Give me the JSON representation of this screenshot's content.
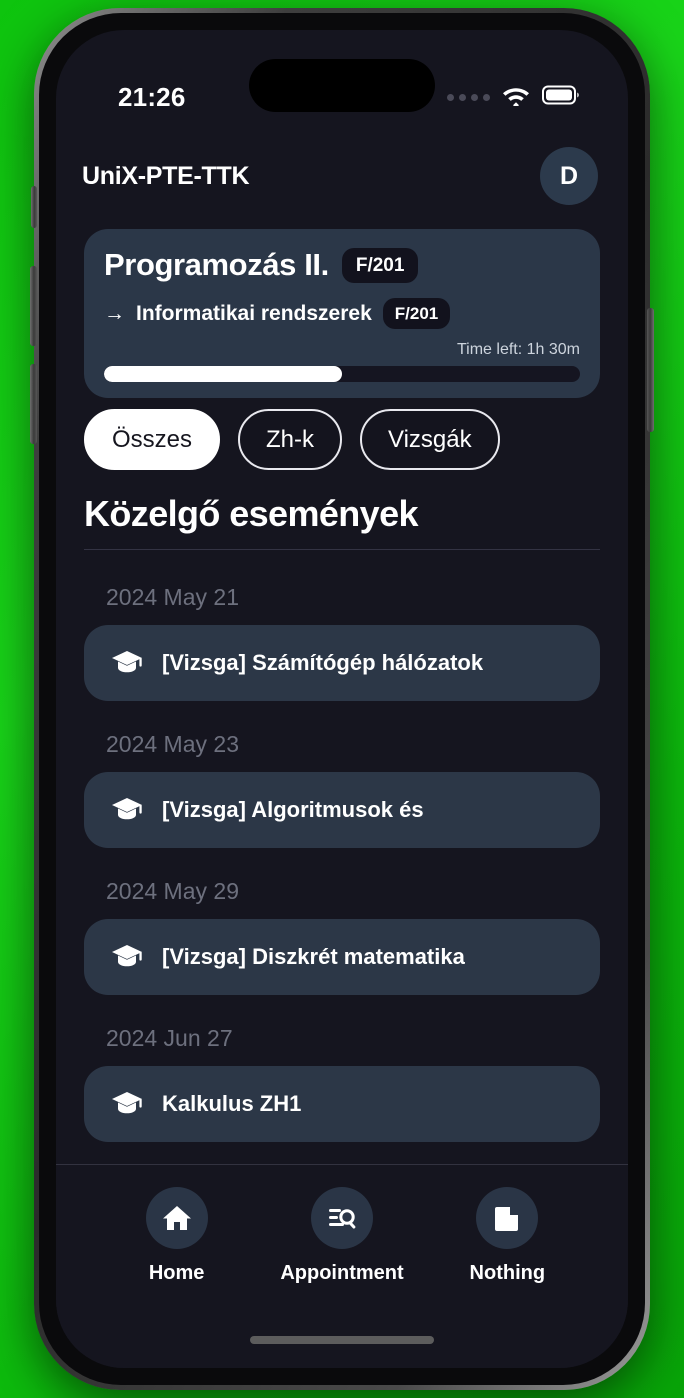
{
  "device": {
    "frame": "iphone-mockup",
    "backdrop_color": "#13c913",
    "screen_bg": "#15151f"
  },
  "status_bar": {
    "time": "21:26",
    "cellular_icon": "cellular-dots-icon",
    "wifi_icon": "wifi-icon",
    "battery_icon": "battery-full-icon"
  },
  "header": {
    "title": "UniX-PTE-TTK",
    "avatar_initial": "D"
  },
  "current_class_card": {
    "title": "Programozás II.",
    "room": "F/201",
    "next_arrow": "→",
    "next_title": "Informatikai rendszerek",
    "next_room": "F/201",
    "time_left": "Time left: 1h 30m",
    "progress_percent": 50
  },
  "filters": [
    {
      "label": "Összes",
      "active": true
    },
    {
      "label": "Zh-k",
      "active": false
    },
    {
      "label": "Vizsgák",
      "active": false
    }
  ],
  "events_section": {
    "heading": "Közelgő események",
    "groups": [
      {
        "date": "2024 May 21",
        "items": [
          {
            "icon": "graduation-cap-icon",
            "title": "[Vizsga] Számítógép hálózatok"
          }
        ]
      },
      {
        "date": "2024 May 23",
        "items": [
          {
            "icon": "graduation-cap-icon",
            "title": "[Vizsga] Algoritmusok és"
          }
        ]
      },
      {
        "date": "2024 May 29",
        "items": [
          {
            "icon": "graduation-cap-icon",
            "title": "[Vizsga] Diszkrét matematika"
          }
        ]
      },
      {
        "date": "2024 Jun 27",
        "items": [
          {
            "icon": "graduation-cap-icon",
            "title": "Kalkulus ZH1"
          }
        ]
      }
    ]
  },
  "bottom_nav": [
    {
      "label": "Home",
      "icon": "home-icon"
    },
    {
      "label": "Appointment",
      "icon": "document-search-icon"
    },
    {
      "label": "Nothing",
      "icon": "file-icon"
    }
  ]
}
